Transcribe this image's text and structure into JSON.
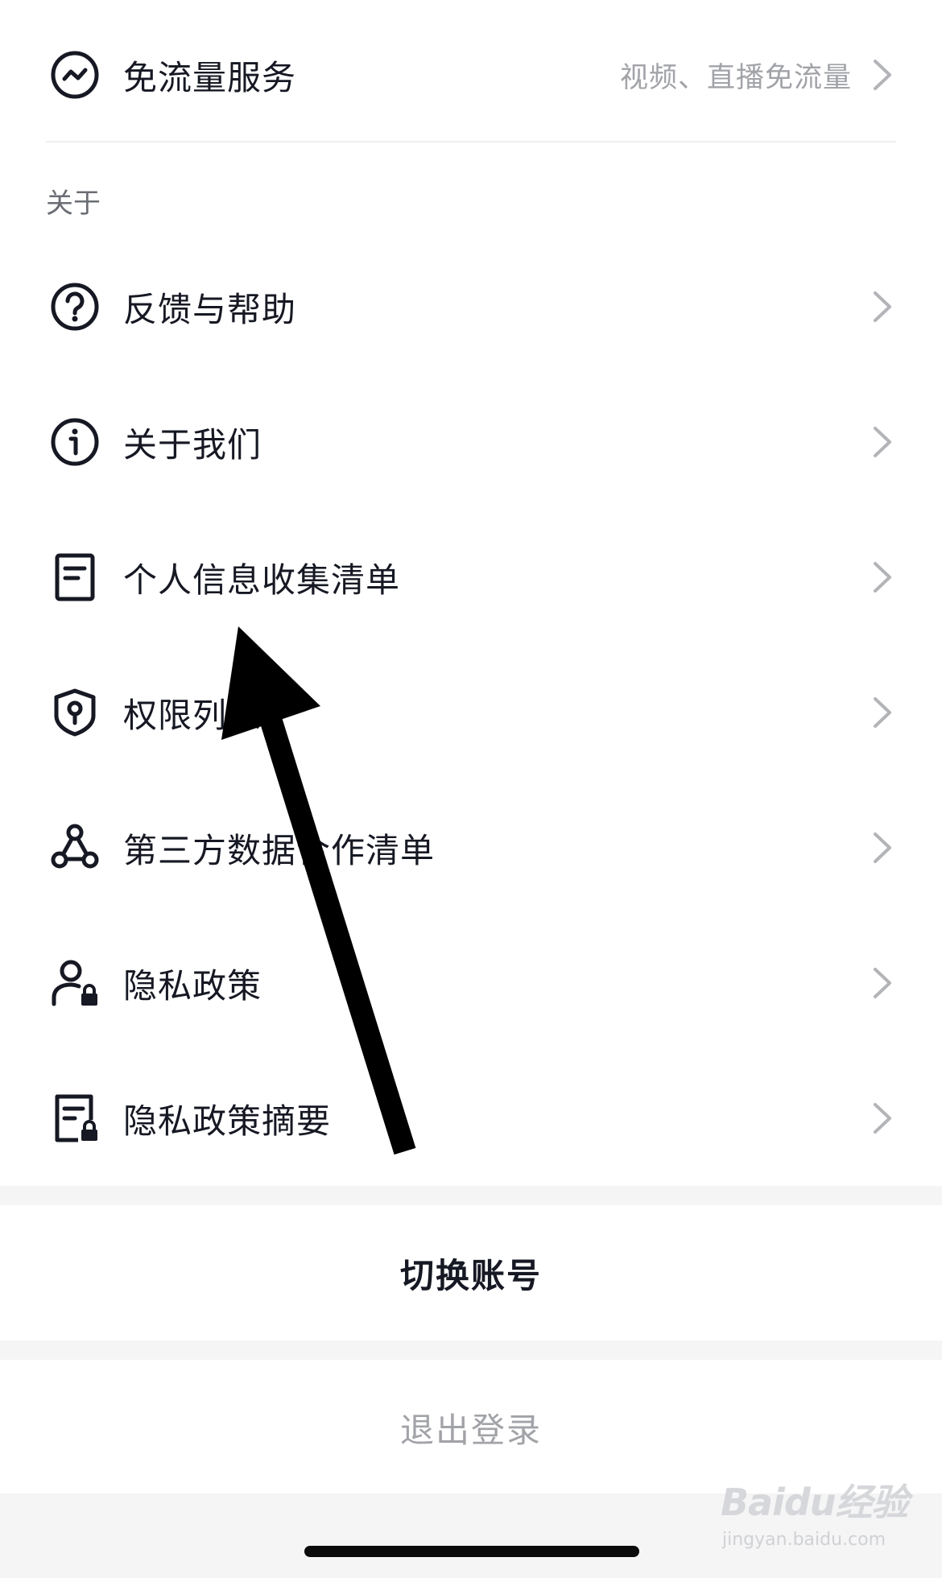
{
  "top_item": {
    "label": "免流量服务",
    "value": "视频、直播免流量",
    "icon": "data-saver-icon"
  },
  "section_title": "关于",
  "about_items": [
    {
      "label": "反馈与帮助",
      "icon": "question-circle-icon"
    },
    {
      "label": "关于我们",
      "icon": "info-circle-icon"
    },
    {
      "label": "个人信息收集清单",
      "icon": "document-icon"
    },
    {
      "label": "权限列表",
      "icon": "shield-key-icon"
    },
    {
      "label": "第三方数据合作清单",
      "icon": "triangle-nodes-icon"
    },
    {
      "label": "隐私政策",
      "icon": "user-lock-icon"
    },
    {
      "label": "隐私政策摘要",
      "icon": "document-lock-icon"
    }
  ],
  "actions": {
    "switch_account": "切换账号",
    "logout": "退出登录"
  },
  "watermark": {
    "logo": "Baidu经验",
    "url": "jingyan.baidu.com"
  },
  "colors": {
    "primary_text": "#161823",
    "secondary_text": "#a2a3a8",
    "section_text": "#6b6d74",
    "band": "#f5f5f6",
    "arrow": "#000000"
  }
}
